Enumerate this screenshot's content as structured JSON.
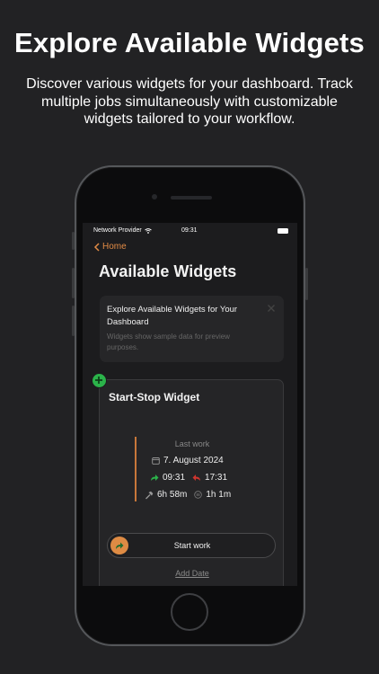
{
  "promo": {
    "title": "Explore Available Widgets",
    "subtitle": "Discover various widgets for your dashboard. Track multiple jobs simultaneously with customizable widgets tailored to your workflow."
  },
  "status_bar": {
    "provider": "Network Provider",
    "time": "09:31"
  },
  "nav": {
    "back_label": "Home"
  },
  "page": {
    "title": "Available Widgets"
  },
  "info_card": {
    "title": "Explore Available Widgets for Your Dashboard",
    "text": "Widgets show sample data for preview purposes."
  },
  "widget": {
    "title": "Start-Stop Widget",
    "last_work_label": "Last work",
    "date": "7. August 2024",
    "start_time": "09:31",
    "end_time": "17:31",
    "work_duration": "6h 58m",
    "pause_duration": "1h 1m",
    "start_button_label": "Start work",
    "add_date_label": "Add Date"
  },
  "colors": {
    "accent": "#e28b45",
    "start_arrow": "#2bb34a",
    "end_arrow": "#d0352e",
    "add_badge": "#2bb34a"
  },
  "icons": [
    "wifi-icon",
    "battery-icon",
    "chevron-left-icon",
    "close-icon",
    "plus-icon",
    "calendar-icon",
    "arrow-right-icon",
    "arrow-left-icon",
    "hammer-icon",
    "pause-icon"
  ]
}
